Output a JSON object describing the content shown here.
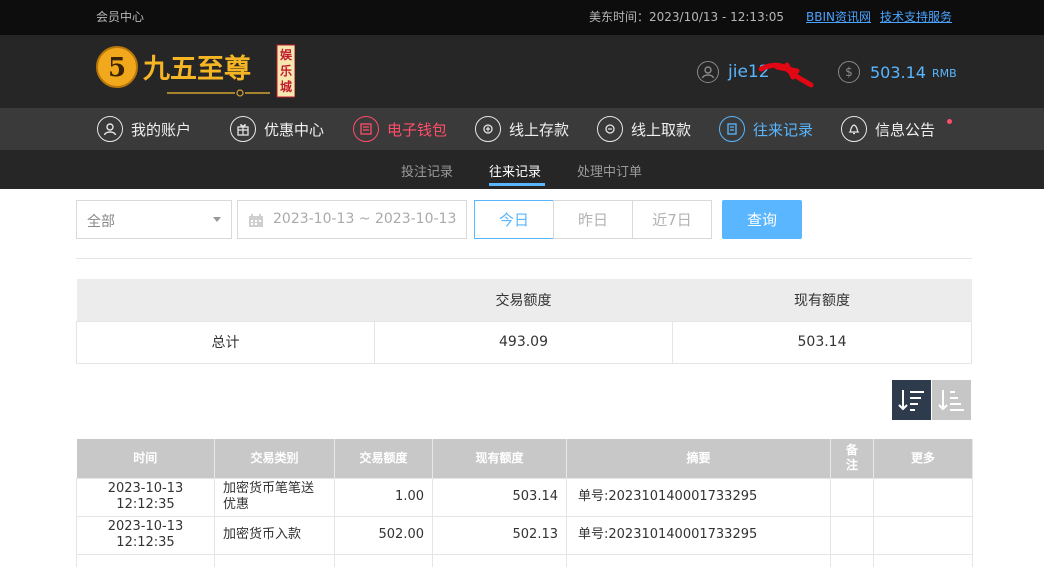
{
  "topbar": {
    "member_center": "会员中心",
    "time_label": "美东时间：2023/10/13 - 12:13:05",
    "link_news": "BBIN资讯网",
    "link_support": "技术支持服务"
  },
  "header": {
    "logo": {
      "digit": "5",
      "title": "九五至尊",
      "badge": "娱乐城"
    },
    "username": "jie12",
    "balance": "503.14",
    "currency": "RMB"
  },
  "nav": {
    "items": [
      {
        "label": "我的账户",
        "icon": "user-icon"
      },
      {
        "label": "优惠中心",
        "icon": "gift-icon"
      },
      {
        "label": "电子钱包",
        "icon": "wallet-icon"
      },
      {
        "label": "线上存款",
        "icon": "deposit-icon"
      },
      {
        "label": "线上取款",
        "icon": "withdraw-icon"
      },
      {
        "label": "往来记录",
        "icon": "record-icon"
      },
      {
        "label": "信息公告",
        "icon": "bell-icon"
      }
    ]
  },
  "subnav": {
    "tabs": [
      "投注记录",
      "往来记录",
      "处理中订单"
    ],
    "active": "往来记录"
  },
  "filters": {
    "type_select": "全部",
    "date_range": "2023-10-13 ~ 2023-10-13",
    "quick": [
      "今日",
      "昨日",
      "近7日"
    ],
    "query": "查询"
  },
  "summary": {
    "headers": [
      "",
      "交易额度",
      "现有额度"
    ],
    "row": [
      "总计",
      "493.09",
      "503.14"
    ]
  },
  "table": {
    "headers": [
      "时间",
      "交易类别",
      "交易额度",
      "现有额度",
      "摘要",
      "备注",
      "更多"
    ],
    "rows": [
      [
        "2023-10-13 12:12:35",
        "加密货币笔笔送优惠",
        "1.00",
        "503.14",
        "单号:202310140001733295",
        "",
        ""
      ],
      [
        "2023-10-13 12:12:35",
        "加密货币入款",
        "502.00",
        "502.13",
        "单号:202310140001733295",
        "",
        ""
      ]
    ]
  },
  "colors": {
    "accent": "#59b6ff",
    "active_red": "#ff4d6a",
    "topbar_bg": "#0d0d0d",
    "header_bg": "#262626",
    "nav_bg": "#3a3a3a",
    "table_header_bg": "#c8c8c8"
  }
}
